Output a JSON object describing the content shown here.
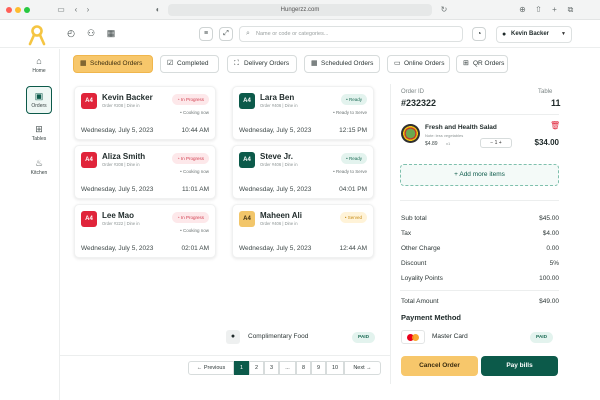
{
  "browser": {
    "url": "Hungerzz.com",
    "colors": {
      "close": "#ff5f57",
      "minimize": "#febc2e",
      "maximize": "#28c840"
    }
  },
  "header": {
    "search_placeholder": "Name or code or categories...",
    "user_name": "Kevin Backer"
  },
  "sidebar": {
    "items": [
      {
        "label": "Home",
        "icon": "home-icon"
      },
      {
        "label": "Orders",
        "icon": "orders-icon"
      },
      {
        "label": "Tables",
        "icon": "tables-icon"
      },
      {
        "label": "Kitchen",
        "icon": "kitchen-icon"
      }
    ]
  },
  "tabs": [
    {
      "label": "Scheduled Orders"
    },
    {
      "label": "Completed"
    },
    {
      "label": "Delivery Orders"
    },
    {
      "label": "Scheduled Orders"
    },
    {
      "label": "Online Orders"
    },
    {
      "label": "QR Orders"
    }
  ],
  "orders": [
    {
      "table": "A4",
      "name": "Kevin Backer",
      "sub": "Order #208 | Dine in",
      "status": "In Progress",
      "substatus": "Cooking now",
      "date": "Wednesday, July 5, 2023",
      "time": "10:44 AM"
    },
    {
      "table": "A4",
      "name": "Lara Ben",
      "sub": "Order #406 | Dine in",
      "status": "Ready",
      "substatus": "Ready to Serve",
      "date": "Wednesday, July 5, 2023",
      "time": "12:15 PM"
    },
    {
      "table": "A4",
      "name": "Aliza Smith",
      "sub": "Order #208 | Dine in",
      "status": "In Progress",
      "substatus": "Cooking now",
      "date": "Wednesday, July 5, 2023",
      "time": "11:01 AM"
    },
    {
      "table": "A4",
      "name": "Steve Jr.",
      "sub": "Order #406 | Dine in",
      "status": "Ready",
      "substatus": "Ready to Serve",
      "date": "Wednesday, July 5, 2023",
      "time": "04:01 PM"
    },
    {
      "table": "A4",
      "name": "Lee Mao",
      "sub": "Order #222 | Dine in",
      "status": "In Progress",
      "substatus": "Cooking now",
      "date": "Wednesday, July 5, 2023",
      "time": "02:01 AM"
    },
    {
      "table": "A4",
      "name": "Maheen Ali",
      "sub": "Order #406 | Dine in",
      "status": "Served",
      "substatus": "",
      "date": "Wednesday, July 5, 2023",
      "time": "12:44 AM"
    }
  ],
  "complimentary": {
    "label": "Complimentary Food",
    "status": "PAID"
  },
  "pagination": {
    "prev": "Previous",
    "next": "Next",
    "pages": [
      "1",
      "2",
      "3",
      "...",
      "8",
      "9",
      "10"
    ]
  },
  "panel": {
    "order_id_label": "Order ID",
    "order_id": "#232322",
    "table_label": "Table",
    "table_no": "11",
    "item": {
      "name": "Fresh and Health Salad",
      "note": "Note: less vegetables",
      "price": "$4.89",
      "qty_label": "x1",
      "qty": "1",
      "total": "$34.00"
    },
    "add_more": "+ Add more items",
    "summary": [
      {
        "label": "Sub total",
        "value": "$45.00"
      },
      {
        "label": "Tax",
        "value": "$4.00"
      },
      {
        "label": "Other Charge",
        "value": "0.00"
      },
      {
        "label": "Discount",
        "value": "5%"
      },
      {
        "label": "Loyality Points",
        "value": "100.00"
      }
    ],
    "total": {
      "label": "Total Amount",
      "value": "$49.00"
    },
    "payment_title": "Payment Method",
    "payment_method": "Master Card",
    "payment_status": "PAID",
    "cancel_label": "Cancel Order",
    "pay_label": "Pay bills"
  },
  "colors": {
    "accent": "#f7c76b",
    "primary": "#0c5a4a",
    "in_progress_bg": "#fde8ea",
    "in_progress_text": "#d03a4c",
    "ready_bg": "#e3f3ee",
    "ready_text": "#1c6b55",
    "served_bg": "#fff3d8",
    "served_text": "#c58a14",
    "table_red": "#e0243a",
    "table_green": "#0c5a4a",
    "table_yellow": "#f2c66a"
  }
}
